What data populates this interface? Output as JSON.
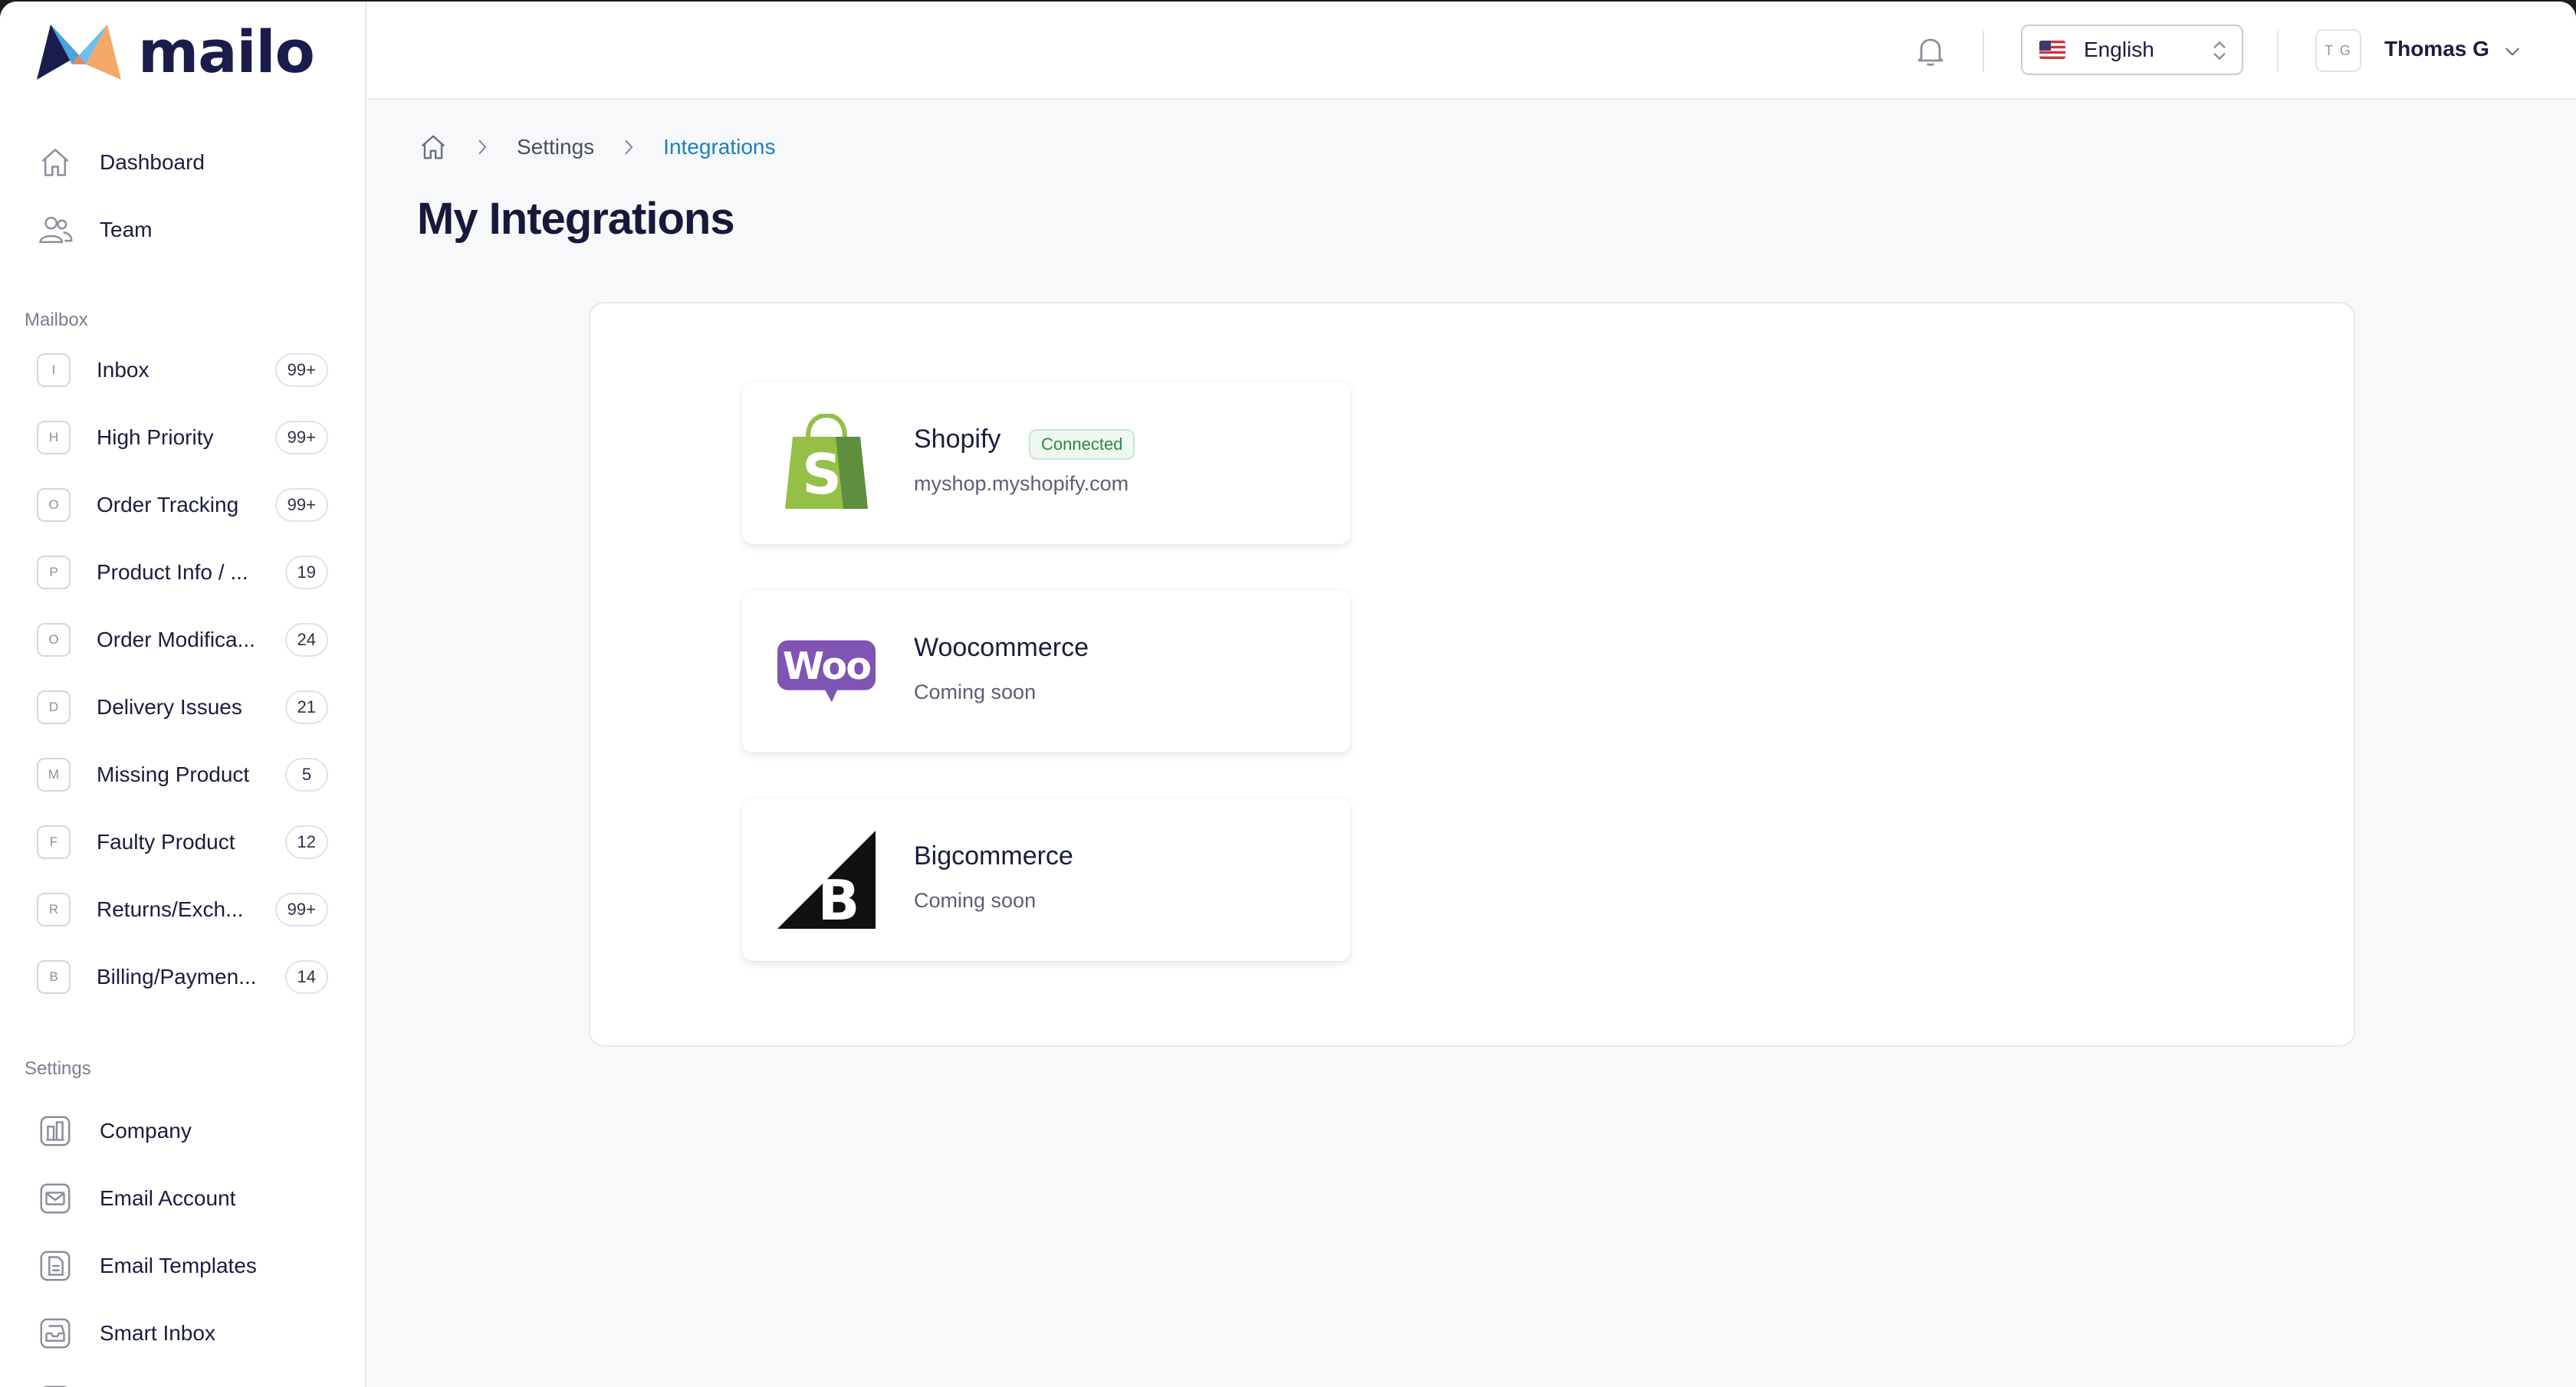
{
  "brand": {
    "name": "mailo"
  },
  "sidebar": {
    "top_items": [
      {
        "label": "Dashboard",
        "icon": "home-icon"
      },
      {
        "label": "Team",
        "icon": "users-icon"
      }
    ],
    "mailbox_section": "Mailbox",
    "mailbox_items": [
      {
        "letter": "I",
        "label": "Inbox",
        "count": "99+"
      },
      {
        "letter": "H",
        "label": "High Priority",
        "count": "99+"
      },
      {
        "letter": "O",
        "label": "Order Tracking",
        "count": "99+"
      },
      {
        "letter": "P",
        "label": "Product Info / ...",
        "count": "19"
      },
      {
        "letter": "O",
        "label": "Order Modifica...",
        "count": "24"
      },
      {
        "letter": "D",
        "label": "Delivery Issues",
        "count": "21"
      },
      {
        "letter": "M",
        "label": "Missing Product",
        "count": "5"
      },
      {
        "letter": "F",
        "label": "Faulty Product",
        "count": "12"
      },
      {
        "letter": "R",
        "label": "Returns/Exch...",
        "count": "99+"
      },
      {
        "letter": "B",
        "label": "Billing/Paymen...",
        "count": "14"
      }
    ],
    "settings_section": "Settings",
    "settings_items": [
      {
        "label": "Company",
        "icon": "building-icon"
      },
      {
        "label": "Email Account",
        "icon": "envelope-icon"
      },
      {
        "label": "Email Templates",
        "icon": "document-icon"
      },
      {
        "label": "Smart Inbox",
        "icon": "inbox-tray-icon"
      }
    ]
  },
  "header": {
    "language": "English",
    "user_initials": "T G",
    "user_name": "Thomas G"
  },
  "breadcrumb": {
    "items": [
      "Settings",
      "Integrations"
    ]
  },
  "page": {
    "title": "My Integrations"
  },
  "integrations": [
    {
      "name": "Shopify",
      "badge": "Connected",
      "subtitle": "myshop.myshopify.com",
      "logo": "shopify-logo"
    },
    {
      "name": "Woocommerce",
      "subtitle": "Coming soon",
      "logo": "woocommerce-logo"
    },
    {
      "name": "Bigcommerce",
      "subtitle": "Coming soon",
      "logo": "bigcommerce-logo"
    }
  ],
  "colors": {
    "accent": "#1e7fb8",
    "text_dark": "#17193b",
    "connected_green": "#2a8a44",
    "shopify_green": "#95bf47",
    "woo_purple": "#7f54b3"
  }
}
